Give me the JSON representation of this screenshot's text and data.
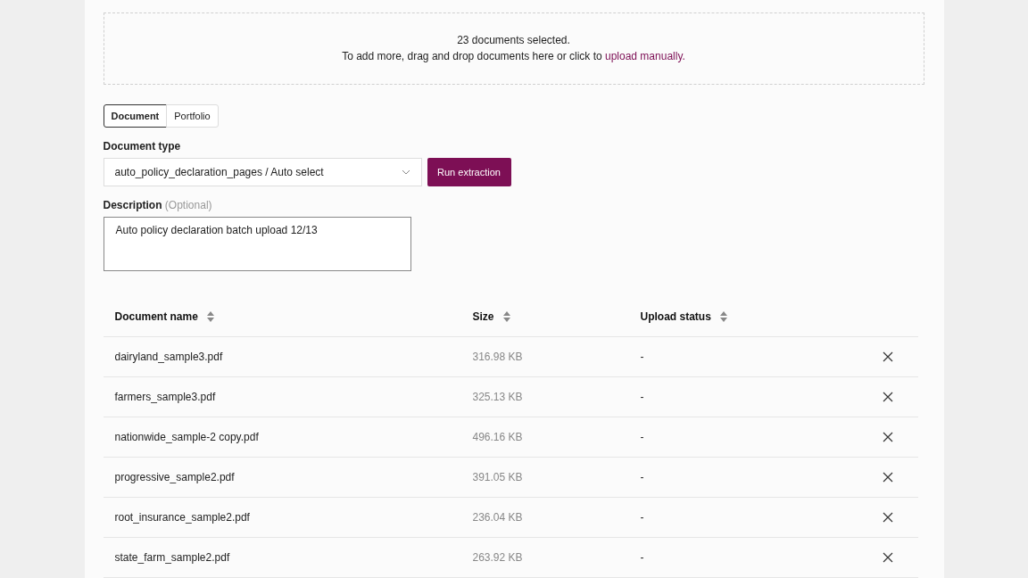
{
  "dropzone": {
    "count_text": "23 documents selected.",
    "hint": "To add more, drag and drop documents here or click to",
    "link": "upload manually."
  },
  "tabs": [
    {
      "label": "Document",
      "selected": true
    },
    {
      "label": "Portfolio",
      "selected": false
    }
  ],
  "document_type": {
    "label": "Document type",
    "value": "auto_policy_declaration_pages / Auto select"
  },
  "run_button": "Run extraction",
  "description": {
    "label": "Description",
    "hint": "(Optional)",
    "value": "Auto policy declaration batch upload 12/13"
  },
  "table": {
    "columns": [
      "Document name",
      "Size",
      "Upload status"
    ],
    "rows": [
      {
        "name": "dairyland_sample3.pdf",
        "size": "316.98 KB",
        "status": "-"
      },
      {
        "name": "farmers_sample3.pdf",
        "size": "325.13 KB",
        "status": "-"
      },
      {
        "name": "nationwide_sample-2 copy.pdf",
        "size": "496.16 KB",
        "status": "-"
      },
      {
        "name": "progressive_sample2.pdf",
        "size": "391.05 KB",
        "status": "-"
      },
      {
        "name": "root_insurance_sample2.pdf",
        "size": "236.04 KB",
        "status": "-"
      },
      {
        "name": "state_farm_sample2.pdf",
        "size": "263.92 KB",
        "status": "-"
      }
    ]
  }
}
